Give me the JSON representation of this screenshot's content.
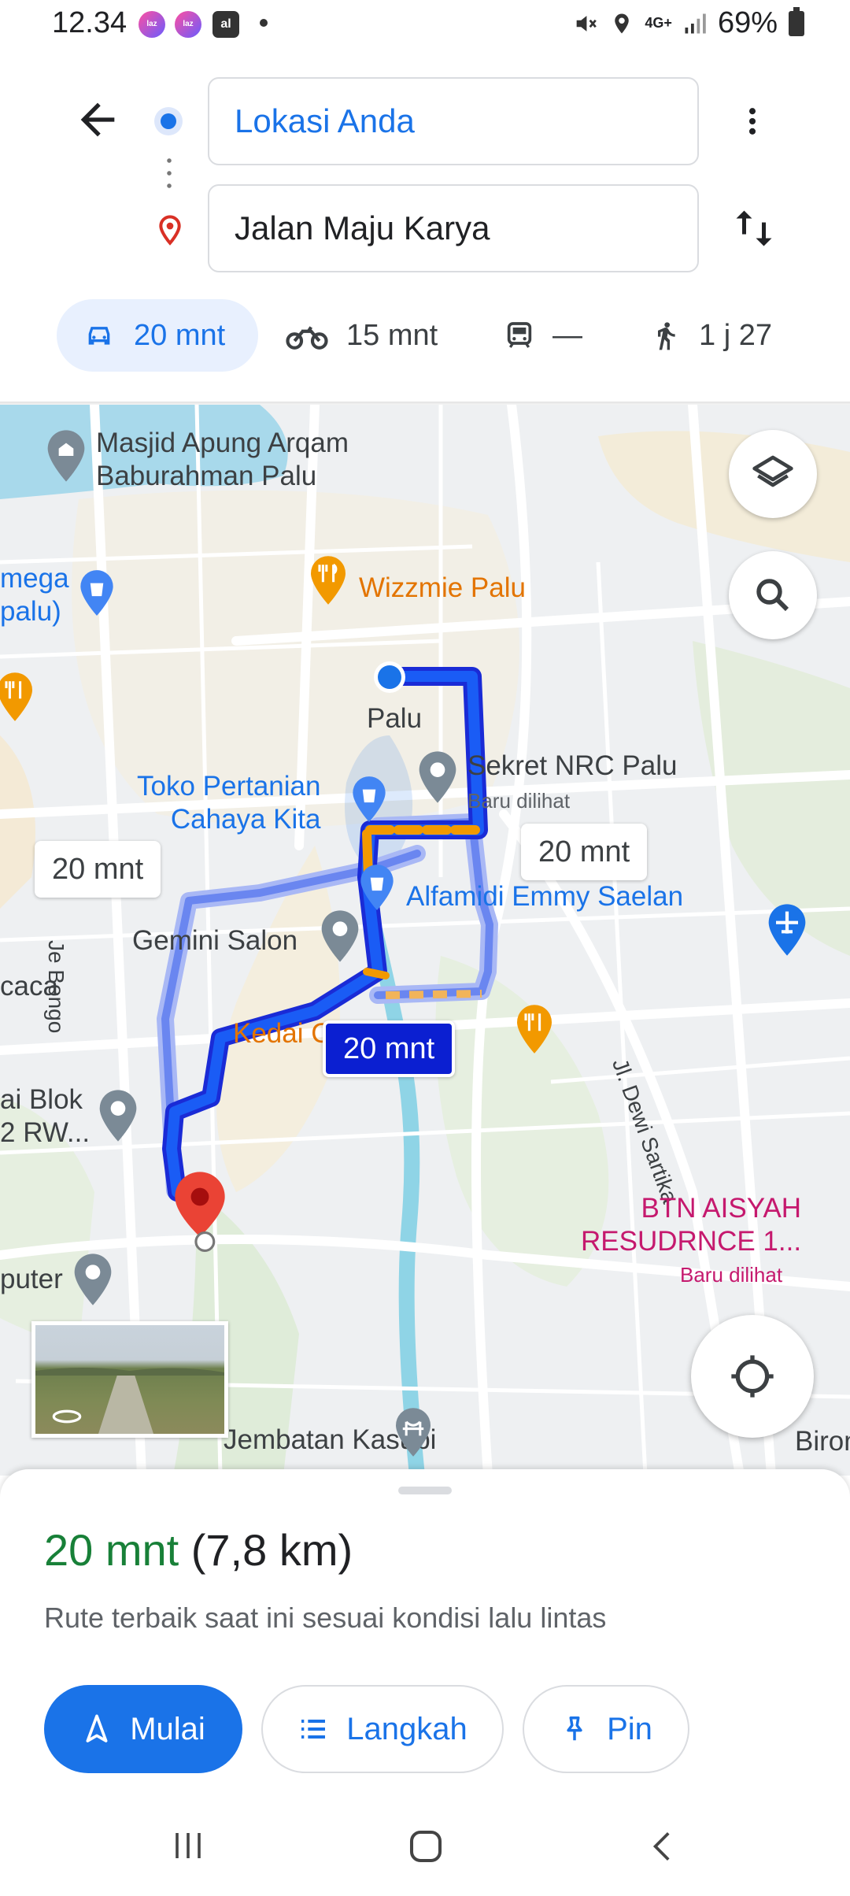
{
  "status_bar": {
    "time": "12.34",
    "app_icons": [
      "laz",
      "laz"
    ],
    "al_icon": "al",
    "battery": "69%",
    "network": "4G+"
  },
  "directions": {
    "origin_value": "Lokasi Anda",
    "destination_value": "Jalan Maju Karya"
  },
  "modes": [
    {
      "name": "car",
      "label": "20 mnt",
      "active": true
    },
    {
      "name": "motorcycle",
      "label": "15 mnt"
    },
    {
      "name": "transit",
      "label": "—"
    },
    {
      "name": "walk",
      "label": "1 j 27"
    }
  ],
  "map": {
    "labels": {
      "masjid": "Masjid Apung Arqam\nBaburahman Palu",
      "omega": "mega\npalu)",
      "wizzmie": "Wizzmie Palu",
      "palu": "Palu",
      "sekret": "Sekret NRC Palu",
      "sekret_sub": "Baru dilihat",
      "toko": "Toko Pertanian\nCahaya Kita",
      "alfamidi": "Alfamidi Emmy Saelan",
      "gemini": "Gemini Salon",
      "kedai": "Kedai Ce       ha",
      "caca": "caca",
      "blok": "ai Blok\n2 RW...",
      "puter": "puter",
      "bongo": "Je Bongo",
      "dewi": "Jl. Dewi Sartika",
      "btn": "BTN AISYAH\nRESUDRNCE 1...",
      "btn_sub": "Baru dilihat",
      "jembatan": "Jembatan Kasubi",
      "birom": "Birom"
    },
    "route_chips": {
      "left": "20 mnt",
      "right": "20 mnt",
      "selected": "20 mnt"
    }
  },
  "sheet": {
    "time": "20 mnt",
    "distance": "(7,8 km)",
    "subtitle": "Rute terbaik saat ini sesuai kondisi lalu lintas",
    "start_label": "Mulai",
    "steps_label": "Langkah",
    "pin_label": "Pin"
  },
  "colors": {
    "accent": "#1a73e8",
    "route_selected": "#0b1fd1",
    "traffic": "#f29900",
    "duration_green": "#188038"
  }
}
